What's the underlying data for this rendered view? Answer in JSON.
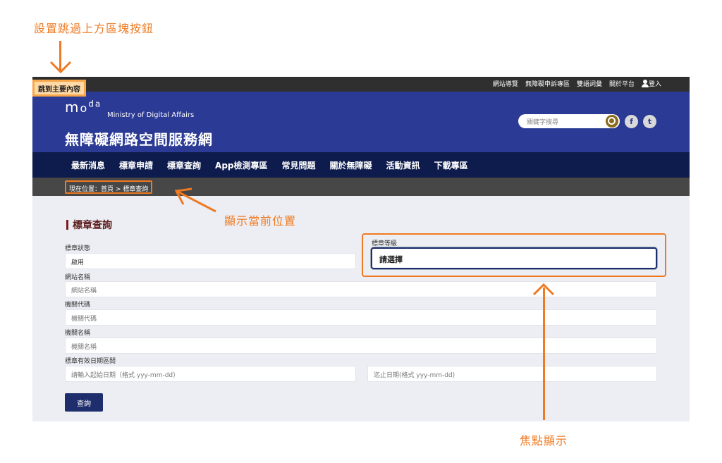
{
  "annotations": {
    "skip_button": "設置跳過上方區塊按鈕",
    "current_location": "顯示當前位置",
    "focus_display": "焦點顯示"
  },
  "skip_link": "跳到主要內容",
  "topbar": {
    "links": [
      "網站導覽",
      "無障礙申訴專區",
      "雙語詞彙",
      "關於平台",
      "登入"
    ]
  },
  "header": {
    "logo": "moda",
    "ministry": "Ministry of Digital Affairs",
    "site_title": "無障礙網路空間服務網",
    "search_placeholder": "關鍵字搜尋",
    "social": [
      "f",
      "t"
    ]
  },
  "nav": [
    "最新消息",
    "標章申請",
    "標章查詢",
    "App檢測專區",
    "常見問題",
    "關於無障礙",
    "活動資訊",
    "下載專區"
  ],
  "breadcrumb": "現在位置：首頁 > 標章查詢",
  "form": {
    "title": "標章查詢",
    "status_label": "標章狀態",
    "status_value": "啟用",
    "level_label": "標章等級",
    "level_value": "請選擇",
    "site_name_label": "網站名稱",
    "site_name_placeholder": "網站名稱",
    "agency_code_label": "機關代碼",
    "agency_code_placeholder": "機關代碼",
    "agency_name_label": "機關名稱",
    "agency_name_placeholder": "機關名稱",
    "date_label": "標章有效日期區間",
    "start_date_placeholder": "請輸入起始日期（格式 yyy-mm-dd）",
    "end_date_placeholder": "迄止日期(格式 yyy-mm-dd)",
    "submit_label": "查詢"
  },
  "colors": {
    "accent": "#f07a22",
    "header": "#2b3a94",
    "nav": "#0d1b4d"
  }
}
